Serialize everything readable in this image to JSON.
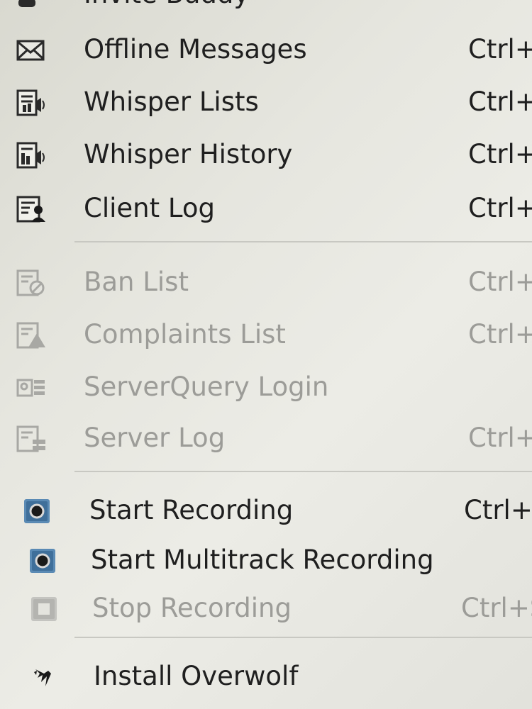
{
  "menu": {
    "items": [
      {
        "label": "Invite Buddy",
        "shortcut": "",
        "icon": "invite-buddy-icon",
        "enabled": true
      },
      {
        "label": "Offline Messages",
        "shortcut": "Ctrl+",
        "icon": "envelope-icon",
        "enabled": true
      },
      {
        "label": "Whisper Lists",
        "shortcut": "Ctrl+",
        "icon": "whisper-lists-icon",
        "enabled": true
      },
      {
        "label": "Whisper History",
        "shortcut": "Ctrl+",
        "icon": "whisper-history-icon",
        "enabled": true
      },
      {
        "label": "Client Log",
        "shortcut": "Ctrl+",
        "icon": "client-log-icon",
        "enabled": true
      },
      {
        "label": "Ban List",
        "shortcut": "Ctrl+",
        "icon": "ban-list-icon",
        "enabled": false
      },
      {
        "label": "Complaints List",
        "shortcut": "Ctrl+",
        "icon": "complaints-list-icon",
        "enabled": false
      },
      {
        "label": "ServerQuery Login",
        "shortcut": "",
        "icon": "serverquery-login-icon",
        "enabled": false
      },
      {
        "label": "Server Log",
        "shortcut": "Ctrl+",
        "icon": "server-log-icon",
        "enabled": false
      },
      {
        "label": "Start Recording",
        "shortcut": "Ctrl+S",
        "icon": "record-icon",
        "enabled": true
      },
      {
        "label": "Start Multitrack Recording",
        "shortcut": "",
        "icon": "record-multitrack-icon",
        "enabled": true
      },
      {
        "label": "Stop Recording",
        "shortcut": "Ctrl+S",
        "icon": "stop-record-icon",
        "enabled": false
      },
      {
        "label": "Install Overwolf",
        "shortcut": "",
        "icon": "overwolf-icon",
        "enabled": true
      }
    ]
  },
  "colors": {
    "text": "#1f1f1f",
    "disabled_text": "#9c9c98",
    "separator": "#c8c8c2",
    "record_icon": "#4a7ba6"
  }
}
